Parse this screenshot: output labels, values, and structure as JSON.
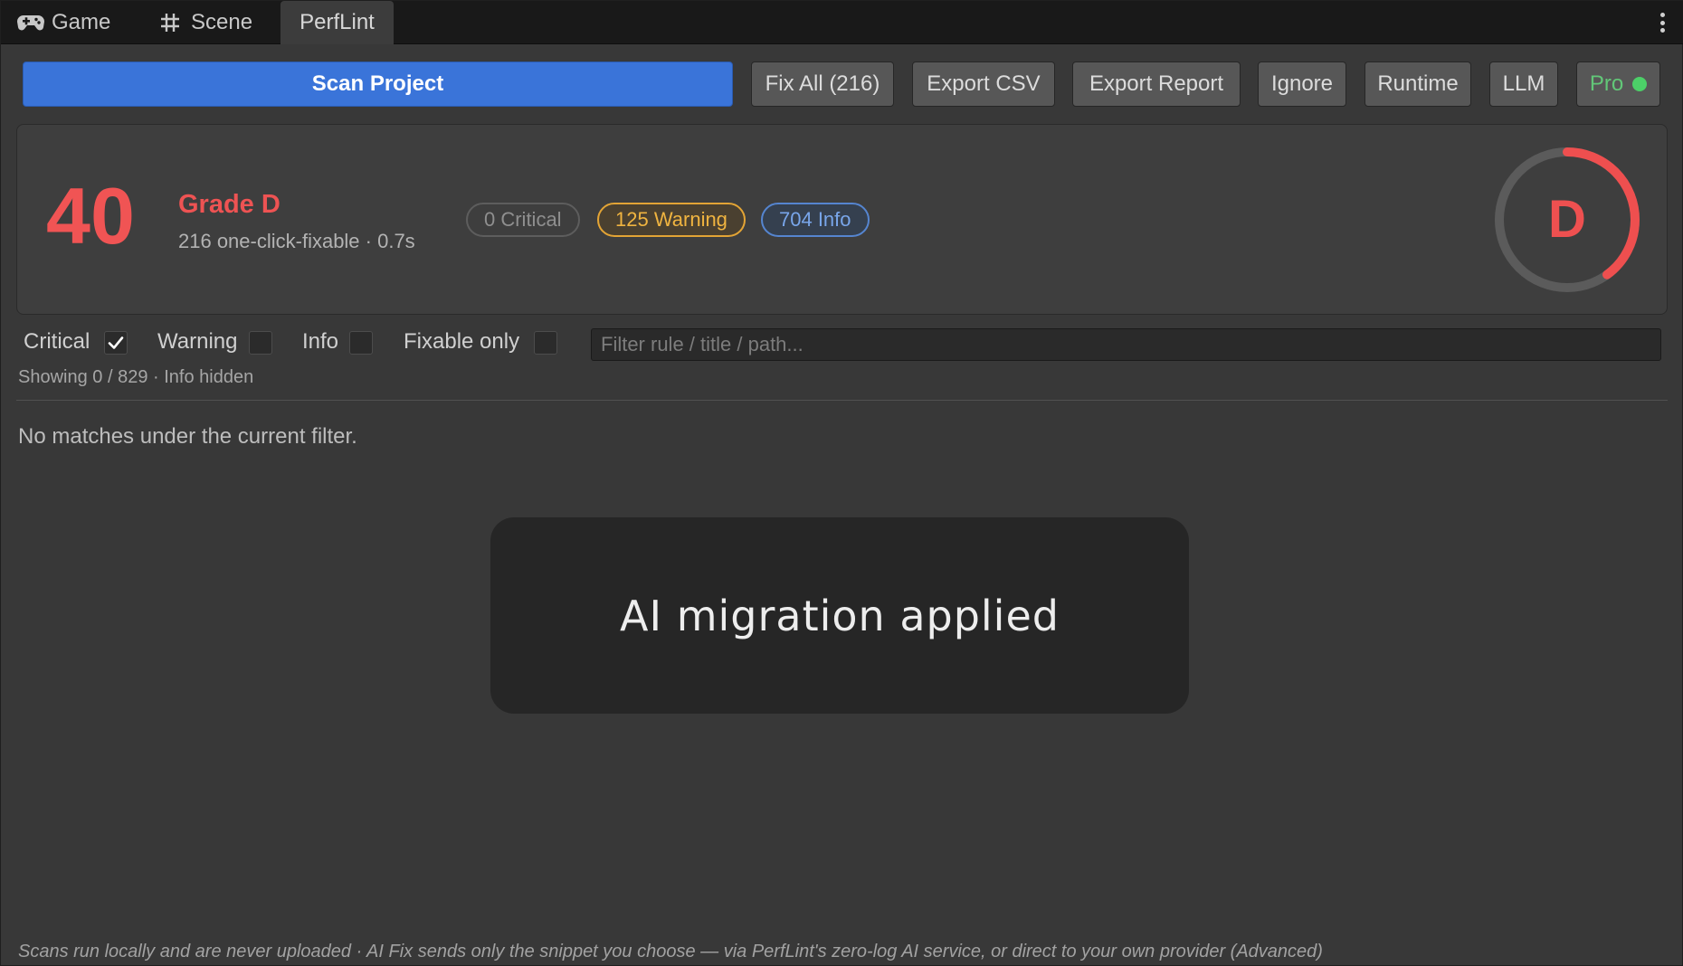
{
  "tabs": {
    "game": "Game",
    "scene": "Scene",
    "perflint": "PerfLint"
  },
  "toolbar": {
    "scan_project": "Scan Project",
    "fix_all": "Fix All (216)",
    "export_csv": "Export CSV",
    "export_report": "Export Report",
    "ignore": "Ignore",
    "runtime": "Runtime",
    "llm": "LLM",
    "pro": "Pro"
  },
  "summary": {
    "score": "40",
    "grade_title": "Grade D",
    "subline": "216 one-click-fixable · 0.7s",
    "critical_badge": "0 Critical",
    "warning_badge": "125 Warning",
    "info_badge": "704 Info",
    "ring_letter": "D",
    "ring_fill_fraction": 0.4
  },
  "filters": {
    "critical": {
      "label": "Critical",
      "checked": true
    },
    "warning": {
      "label": "Warning",
      "checked": false
    },
    "info": {
      "label": "Info",
      "checked": false
    },
    "fixable_only": {
      "label": "Fixable only",
      "checked": false
    },
    "search_placeholder": "Filter rule / title / path...",
    "showing": "Showing 0 / 829 · Info hidden"
  },
  "results": {
    "empty_message": "No matches under the current filter."
  },
  "toast": {
    "message": "AI migration applied"
  },
  "footer": {
    "text": "Scans run locally and are never uploaded · AI Fix sends only the snippet you choose — via PerfLint's zero-log AI service, or direct to your own provider (Advanced)"
  },
  "colors": {
    "accent": "#3a74d9",
    "critical": "#f05454",
    "warning": "#e3a435",
    "info": "#5585d0",
    "pro_dot": "#4cd068"
  }
}
